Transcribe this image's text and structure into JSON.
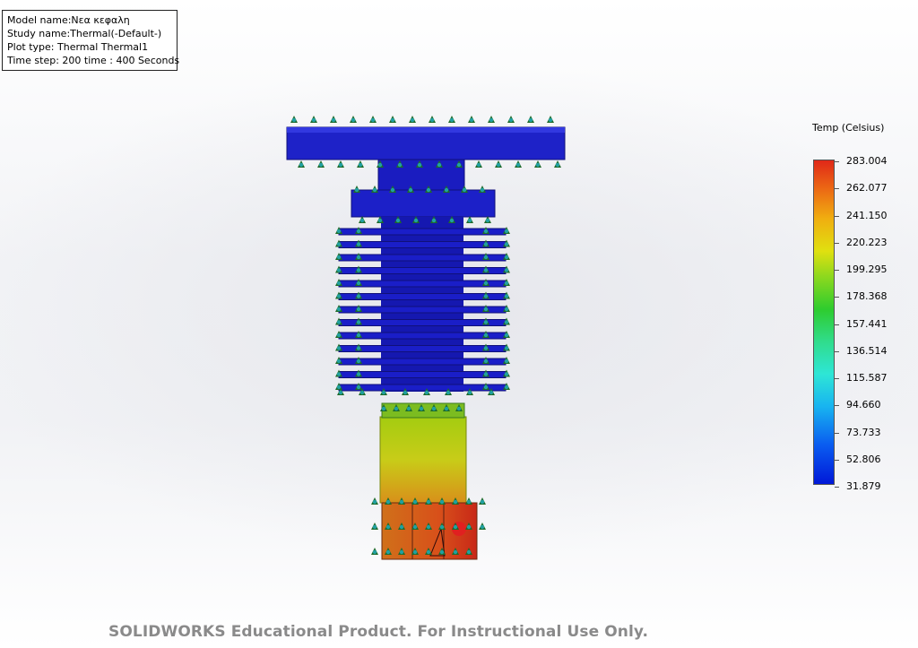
{
  "info": {
    "model_name": "Model name:Νεα κεφαλη",
    "study_name": "Study name:Thermal(-Default-)",
    "plot_type": "Plot type: Thermal Thermal1",
    "time_step": "Time step: 200    time : 400 Seconds"
  },
  "legend": {
    "title": "Temp (Celsius)",
    "ticks": [
      "283.004",
      "262.077",
      "241.150",
      "220.223",
      "199.295",
      "178.368",
      "157.441",
      "136.514",
      "115.587",
      "94.660",
      "73.733",
      "52.806",
      "31.879"
    ],
    "max_color": "#e02818",
    "min_color": "#0018d8"
  },
  "watermark": "SOLIDWORKS Educational Product. For Instructional Use Only.",
  "colors": {
    "cold": "#1a1ad0",
    "mid": "#b8d018",
    "hot": "#d8501a",
    "fixture": "#1f6a2a"
  }
}
